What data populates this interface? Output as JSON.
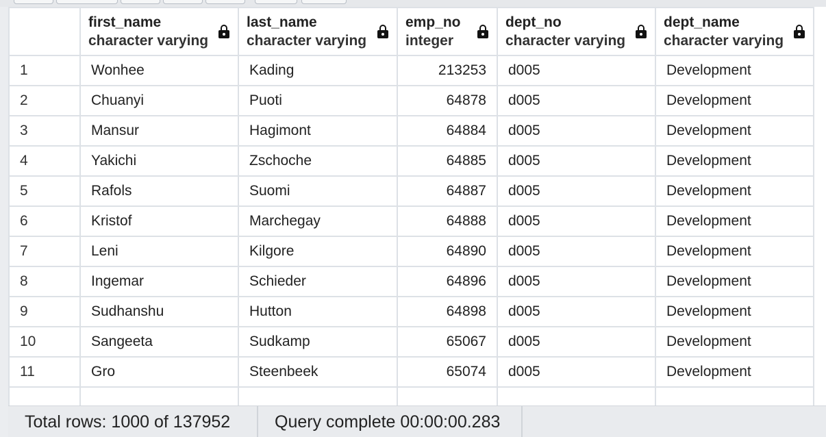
{
  "columns": [
    {
      "name": "",
      "type": ""
    },
    {
      "name": "first_name",
      "type": "character varying"
    },
    {
      "name": "last_name",
      "type": "character varying"
    },
    {
      "name": "emp_no",
      "type": "integer"
    },
    {
      "name": "dept_no",
      "type": "character varying"
    },
    {
      "name": "dept_name",
      "type": "character varying"
    }
  ],
  "rows": [
    [
      "1",
      "Wonhee",
      "Kading",
      "213253",
      "d005",
      "Development"
    ],
    [
      "2",
      "Chuanyi",
      "Puoti",
      "64878",
      "d005",
      "Development"
    ],
    [
      "3",
      "Mansur",
      "Hagimont",
      "64884",
      "d005",
      "Development"
    ],
    [
      "4",
      "Yakichi",
      "Zschoche",
      "64885",
      "d005",
      "Development"
    ],
    [
      "5",
      "Rafols",
      "Suomi",
      "64887",
      "d005",
      "Development"
    ],
    [
      "6",
      "Kristof",
      "Marchegay",
      "64888",
      "d005",
      "Development"
    ],
    [
      "7",
      "Leni",
      "Kilgore",
      "64890",
      "d005",
      "Development"
    ],
    [
      "8",
      "Ingemar",
      "Schieder",
      "64896",
      "d005",
      "Development"
    ],
    [
      "9",
      "Sudhanshu",
      "Hutton",
      "64898",
      "d005",
      "Development"
    ],
    [
      "10",
      "Sangeeta",
      "Sudkamp",
      "65067",
      "d005",
      "Development"
    ],
    [
      "11",
      "Gro",
      "Steenbeek",
      "65074",
      "d005",
      "Development"
    ],
    [
      "",
      "",
      "",
      "",
      "",
      ""
    ]
  ],
  "icons": {
    "column_lock": "lock-icon"
  },
  "status": {
    "total_rows": "Total rows: 1000 of 137952",
    "query_status": "Query complete 00:00:00.283"
  },
  "colors": {
    "grid_border": "#dde1e6",
    "status_background": "#e9ebee"
  }
}
